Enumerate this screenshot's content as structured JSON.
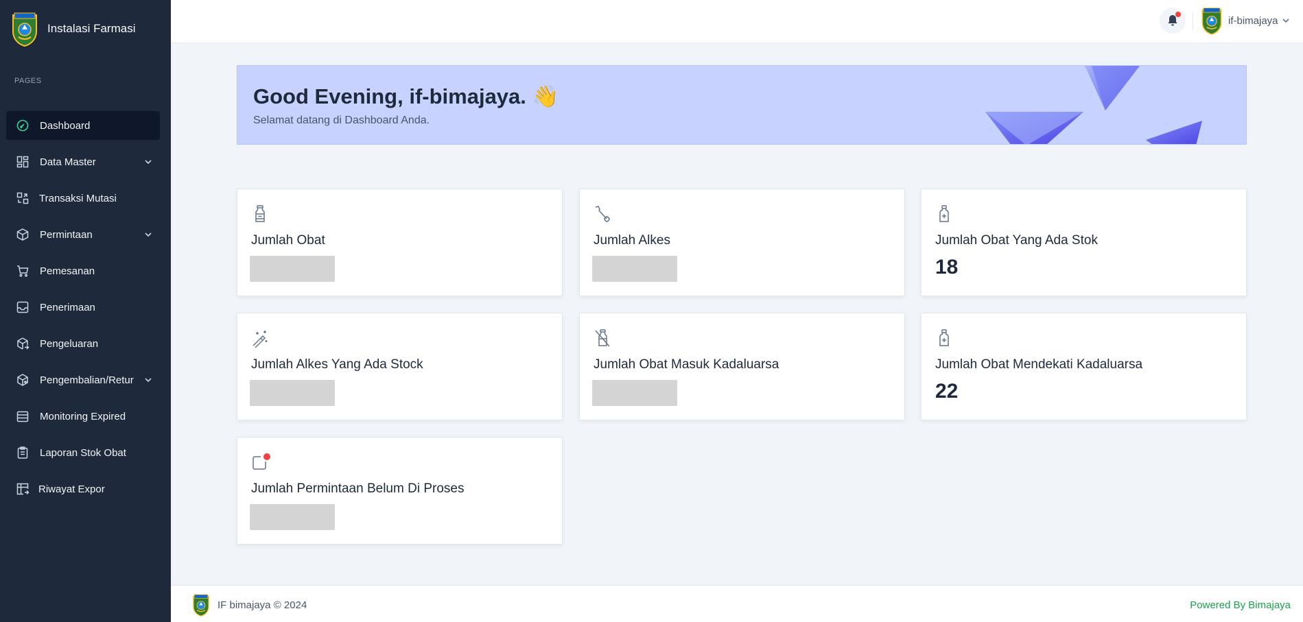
{
  "app": {
    "title": "Instalasi Farmasi"
  },
  "sidebar": {
    "section_label": "PAGES",
    "items": [
      {
        "label": "Dashboard",
        "icon": "dashboard-icon",
        "active": true
      },
      {
        "label": "Data Master",
        "icon": "grid-icon",
        "has_chevron": true
      },
      {
        "label": "Transaksi Mutasi",
        "icon": "transfer-icon"
      },
      {
        "label": "Permintaan",
        "icon": "box-icon",
        "has_chevron": true
      },
      {
        "label": "Pemesanan",
        "icon": "cart-icon"
      },
      {
        "label": "Penerimaan",
        "icon": "inbox-icon"
      },
      {
        "label": "Pengeluaran",
        "icon": "box-out-icon"
      },
      {
        "label": "Pengembalian/Retur",
        "icon": "return-icon",
        "has_chevron": true
      },
      {
        "label": "Monitoring Expired",
        "icon": "calendar-icon"
      },
      {
        "label": "Laporan Stok Obat",
        "icon": "clipboard-icon"
      },
      {
        "label": "Riwayat Expor",
        "icon": "table-export-icon"
      }
    ]
  },
  "header": {
    "user_name": "if-bimajaya",
    "notification_icon": "bell-icon"
  },
  "banner": {
    "greeting": "Good Evening, if-bimajaya. 👋",
    "subtitle": "Selamat datang di Dashboard Anda."
  },
  "cards": [
    {
      "title": "Jumlah Obat",
      "icon": "bottle-icon",
      "value": null
    },
    {
      "title": "Jumlah Alkes",
      "icon": "wrench-icon",
      "value": null
    },
    {
      "title": "Jumlah Obat Yang Ada Stok",
      "icon": "medicine-bottle-plus-icon",
      "value": "18"
    },
    {
      "title": "Jumlah Alkes Yang Ada Stock",
      "icon": "magic-wand-icon",
      "value": null
    },
    {
      "title": "Jumlah Obat Masuk Kadaluarsa",
      "icon": "bottle-off-icon",
      "value": null
    },
    {
      "title": "Jumlah Obat Mendekati Kadaluarsa",
      "icon": "medicine-bottle-plus-icon",
      "value": "22"
    },
    {
      "title": "Jumlah Permintaan Belum Di Proses",
      "icon": "notification-icon",
      "value": null
    }
  ],
  "footer": {
    "copyright": "IF bimajaya © 2024",
    "powered_by": "Powered By Bimajaya"
  },
  "colors": {
    "sidebar_bg": "#1e293b",
    "active_item_bg": "#0f172a",
    "banner_bg": "#c7d2fe",
    "accent_green": "#16a34a",
    "badge_red": "#ef4444"
  }
}
